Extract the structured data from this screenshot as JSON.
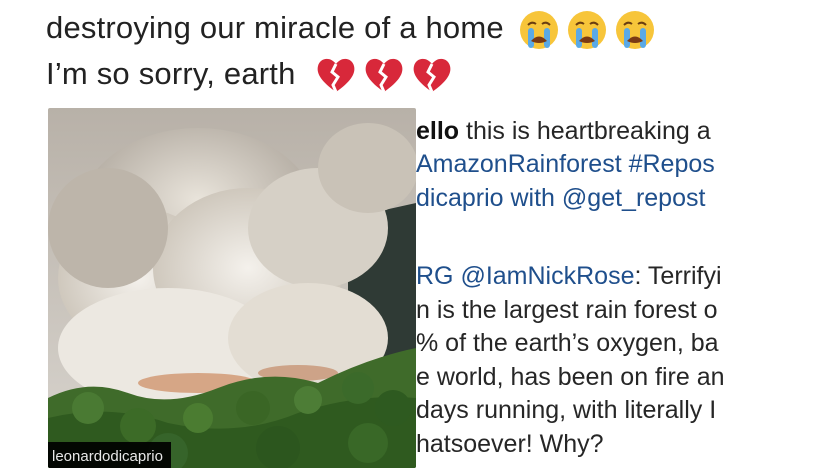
{
  "tweet": {
    "line1": "destroying our miracle of a home",
    "line2": "I’m so sorry, earth",
    "line1_emojis": [
      "crying-face-icon",
      "crying-face-icon",
      "crying-face-icon"
    ],
    "line2_emojis": [
      "broken-heart-icon",
      "broken-heart-icon",
      "broken-heart-icon"
    ]
  },
  "photo": {
    "watermark": "leonardodicaprio"
  },
  "caption": {
    "line1_user": "ello",
    "line1_rest": " this is heartbreaking a",
    "line2": "AmazonRainforest  #Repos",
    "line3_a": "dicaprio with ",
    "line3_b": "@get_repost",
    "line4_a": "RG ",
    "line4_b": "@IamNickRose",
    "line4_c": ": Terrifyi",
    "line5": "n is the largest rain forest o",
    "line6": "% of the earth’s oxygen, ba",
    "line7": "e world, has been on fire an",
    "line8": "days running, with literally I",
    "line9": "hatsoever! Why?"
  },
  "colors": {
    "link": "#1f4f8c",
    "text": "#262626",
    "heart": "#d8283a",
    "emoji_face": "#f7c53a",
    "tears": "#5aa9e6"
  }
}
